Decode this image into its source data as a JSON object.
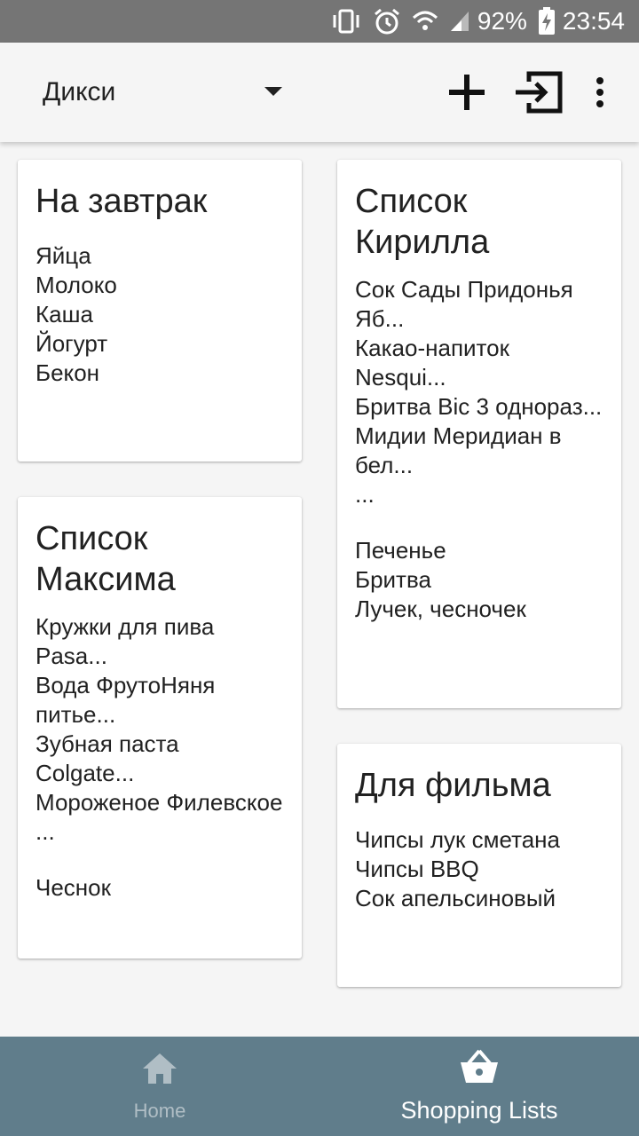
{
  "status_bar": {
    "battery": "92%",
    "time": "23:54"
  },
  "app_bar": {
    "store": "Дикси"
  },
  "lists": [
    {
      "title": "На завтрак",
      "items": [
        "Яйца",
        "Молоко",
        "Каша",
        "Йогурт",
        "Бекон"
      ]
    },
    {
      "title": "Список Кирилла",
      "items": [
        "Сок Сады Придонья Яб...",
        "Какао-напиток Nesqui...",
        "Бритва Bic 3 однораз...",
        "Мидии Меридиан в бел...",
        "...",
        "Печенье",
        "Бритва",
        "Лучек, чесночек"
      ]
    },
    {
      "title": "Список Максима",
      "items": [
        "Кружки для пива Pasa...",
        "Вода ФрутоНяня питье...",
        "Зубная паста Colgate...",
        "Мороженое Филевское ...",
        "Чеснок"
      ]
    },
    {
      "title": "Для фильма",
      "items": [
        "Чипсы лук сметана",
        "Чипсы BBQ",
        "Сок апельсиновый"
      ]
    }
  ],
  "bottom_nav": {
    "home": "Home",
    "lists": "Shopping Lists"
  },
  "colors": {
    "status_bar": "#757575",
    "bottom_nav": "#607d8b",
    "card": "#ffffff",
    "background": "#f5f5f5"
  }
}
